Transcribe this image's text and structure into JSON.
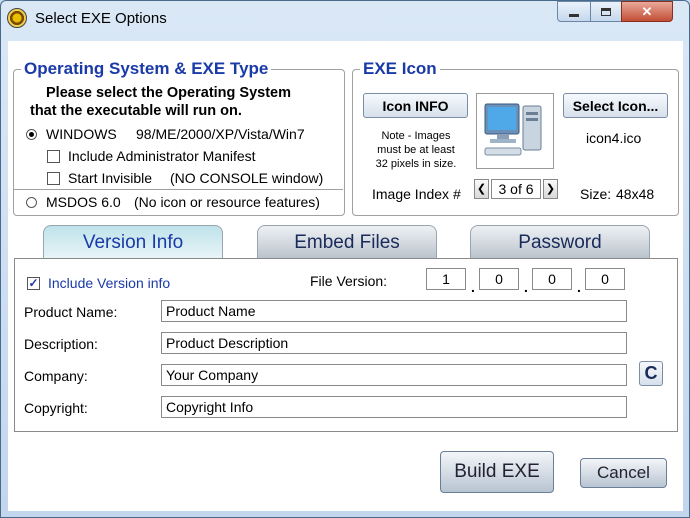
{
  "window": {
    "title": "Select EXE Options",
    "min_icon": "minimize-icon",
    "max_icon": "maximize-icon",
    "close_glyph": "✕"
  },
  "os_group": {
    "legend": "Operating System & EXE Type",
    "instruction_line1": "Please select the Operating System",
    "instruction_line2": "that the executable will run on.",
    "windows_label": "WINDOWS",
    "windows_versions": "98/ME/2000/XP/Vista/Win7",
    "windows_selected": true,
    "admin_manifest_label": "Include Administrator Manifest",
    "admin_manifest_checked": false,
    "start_invisible_label": "Start Invisible",
    "start_invisible_note": "(NO CONSOLE window)",
    "start_invisible_checked": false,
    "msdos_label": "MSDOS 6.0",
    "msdos_note": "(No icon or resource features)",
    "msdos_selected": false
  },
  "icon_group": {
    "legend": "EXE Icon",
    "icon_info_button": "Icon INFO",
    "select_icon_button": "Select Icon...",
    "note_line1": "Note - Images",
    "note_line2": "must be at least",
    "note_line3": "32 pixels in size.",
    "icon_filename": "icon4.ico",
    "image_index_label": "Image Index #",
    "image_index_value": "3 of 6",
    "size_label": "Size:",
    "size_value": "48x48"
  },
  "tabs": [
    {
      "label": "Version Info",
      "active": true
    },
    {
      "label": "Embed Files",
      "active": false
    },
    {
      "label": "Password",
      "active": false
    }
  ],
  "version_info": {
    "include_label": "Include Version info",
    "include_checked": true,
    "file_version_label": "File Version:",
    "file_version": [
      "1",
      "0",
      "0",
      "0"
    ],
    "fields": [
      {
        "label": "Product Name:",
        "value": "Product Name"
      },
      {
        "label": "Description:",
        "value": "Product Description"
      },
      {
        "label": "Company:",
        "value": "Your Company"
      },
      {
        "label": "Copyright:",
        "value": "Copyright Info"
      }
    ],
    "copyright_button": "C"
  },
  "actions": {
    "build_label": "Build EXE",
    "cancel_label": "Cancel"
  },
  "colors": {
    "accent_blue": "#1a3aa8",
    "close_red": "#c24e36"
  }
}
